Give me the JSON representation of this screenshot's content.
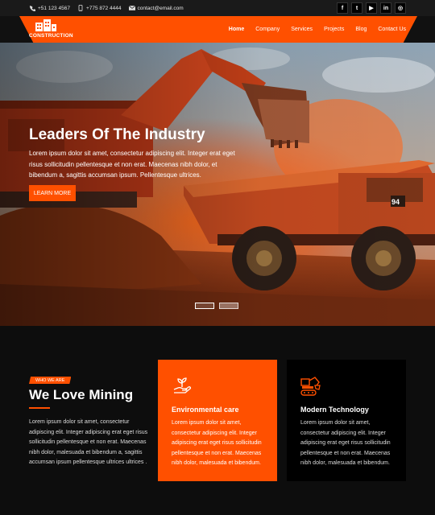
{
  "topbar": {
    "phone": "+51 123 4567",
    "mobile": "+775 872 4444",
    "email": "contact@email.com",
    "socials": [
      "f",
      "t",
      "▶",
      "in",
      "◎"
    ]
  },
  "brand": {
    "name": "CONSTRUCTION"
  },
  "nav": {
    "items": [
      {
        "label": "Home"
      },
      {
        "label": "Company"
      },
      {
        "label": "Services"
      },
      {
        "label": "Projects"
      },
      {
        "label": "Blog"
      },
      {
        "label": "Contact Us"
      }
    ]
  },
  "hero": {
    "title": "Leaders Of The Industry",
    "text": "Lorem ipsum dolor sit amet, consectetur adipiscing elit. Integer erat eget risus sollicitudin pellentesque et non erat. Maecenas nibh dolor, et bibendum a, sagittis accumsan ipsum. Pellentesque ultrices.",
    "button": "LEARN MORE",
    "truck_number": "94"
  },
  "about": {
    "tag": "WHO WE ARE",
    "title": "We Love Mining",
    "text": "Lorem ipsum dolor sit amet, consectetur adipiscing elit. Integer adipiscing erat eget risus sollicitudin pellentesque et non erat. Maecenas nibh dolor, malesuada et bibendum a, sagittis accumsan ipsum pellentesque ultrices ultrices ."
  },
  "cards": [
    {
      "title": "Environmental care",
      "text": "Lorem ipsum dolor sit amet, consectetur adipiscing elit. Integer adipiscing erat eget risus sollicitudin pellentesque et non erat. Maecenas nibh dolor, malesuada et bibendum."
    },
    {
      "title": "Modern Technology",
      "text": "Lorem ipsum dolor sit amet, consectetur adipiscing elit. Integer adipiscing erat eget risus sollicitudin pellentesque et non erat. Maecenas nibh dolor, malesuada et bibendum."
    }
  ],
  "colors": {
    "accent": "#ff5000",
    "dark": "#0d0d0d"
  }
}
